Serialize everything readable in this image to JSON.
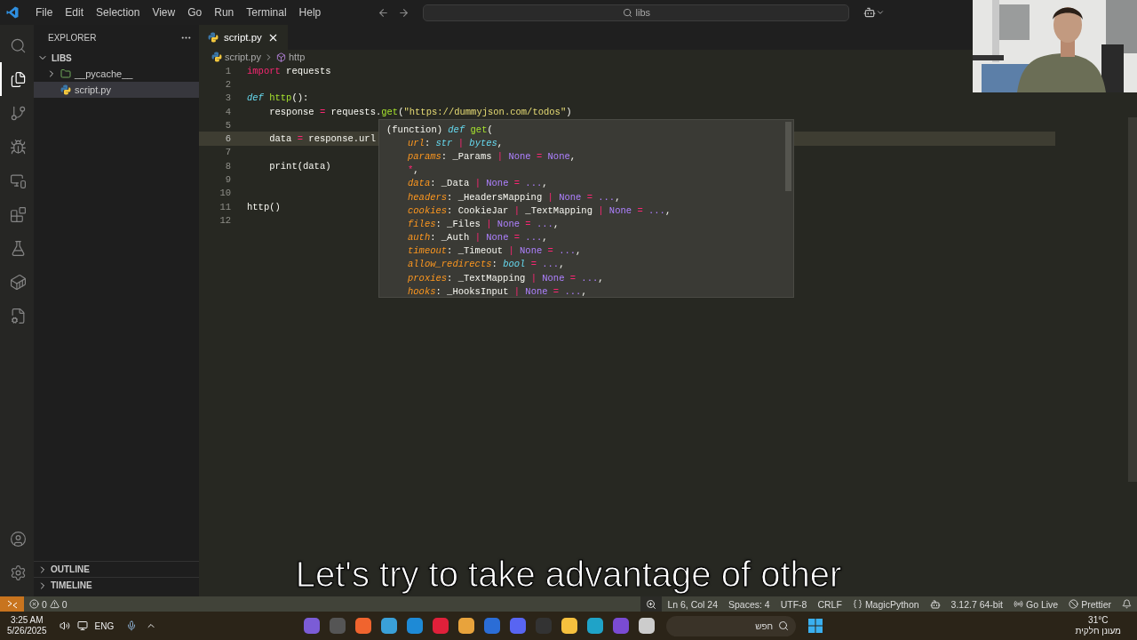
{
  "menu": [
    "File",
    "Edit",
    "Selection",
    "View",
    "Go",
    "Run",
    "Terminal",
    "Help"
  ],
  "search": {
    "value": "libs"
  },
  "activity": [
    {
      "selected": false
    },
    {
      "selected": true
    },
    {
      "selected": false
    },
    {
      "selected": false
    },
    {
      "selected": false
    },
    {
      "selected": false
    },
    {
      "selected": false
    },
    {
      "selected": false
    },
    {
      "selected": false
    }
  ],
  "explorer": {
    "title": "EXPLORER",
    "root": {
      "label": "LIBS",
      "expanded": true,
      "children": [
        {
          "label": "__pycache__",
          "kind": "folder",
          "expanded": false,
          "selected": false
        },
        {
          "label": "script.py",
          "kind": "python",
          "selected": true
        }
      ]
    }
  },
  "sections": [
    {
      "label": "OUTLINE",
      "expanded": false
    },
    {
      "label": "TIMELINE",
      "expanded": false
    }
  ],
  "tabs": [
    {
      "label": "script.py",
      "selected": true
    }
  ],
  "breadcrumbs": [
    "script.py",
    "http"
  ],
  "code": [
    {
      "number": "1",
      "selected": false,
      "tokens": [
        {
          "kind": "kw",
          "text": "import"
        },
        {
          "kind": "plain",
          "text": " requests"
        }
      ]
    },
    {
      "number": "2",
      "selected": false
    },
    {
      "number": "3",
      "selected": false,
      "tokens": [
        {
          "kind": "kwi",
          "text": "def "
        },
        {
          "kind": "fn",
          "text": "http"
        },
        {
          "kind": "plain",
          "text": "():"
        }
      ]
    },
    {
      "number": "4",
      "selected": false,
      "tokens": [
        {
          "kind": "plain",
          "text": "    response "
        },
        {
          "kind": "op",
          "text": "="
        },
        {
          "kind": "plain",
          "text": " requests."
        },
        {
          "kind": "fn",
          "text": "get"
        },
        {
          "kind": "plain",
          "text": "("
        },
        {
          "kind": "str",
          "text": "\"https://dummyjson.com/todos\""
        },
        {
          "kind": "plain",
          "text": ")"
        }
      ]
    },
    {
      "number": "5",
      "selected": false
    },
    {
      "number": "6",
      "selected": true,
      "tokens": [
        {
          "kind": "plain",
          "text": "    data "
        },
        {
          "kind": "op",
          "text": "="
        },
        {
          "kind": "plain",
          "text": " response.url"
        }
      ]
    },
    {
      "number": "7",
      "selected": false
    },
    {
      "number": "8",
      "selected": false,
      "tokens": [
        {
          "kind": "plain",
          "text": "    print(data)"
        }
      ]
    },
    {
      "number": "9",
      "selected": false
    },
    {
      "number": "10",
      "selected": false
    },
    {
      "number": "11",
      "selected": false,
      "tokens": [
        {
          "kind": "plain",
          "text": "http()"
        }
      ]
    },
    {
      "number": "12",
      "selected": false
    }
  ],
  "hover": [
    {
      "indented": false,
      "tokens": [
        {
          "kind": "plain",
          "text": "(function) "
        },
        {
          "kind": "kwi",
          "text": "def "
        },
        {
          "kind": "fn",
          "text": "get"
        },
        {
          "kind": "plain",
          "text": "("
        }
      ]
    },
    {
      "indented": true,
      "tokens": [
        {
          "kind": "param",
          "text": "url"
        },
        {
          "kind": "plain",
          "text": ": "
        },
        {
          "kind": "type",
          "text": "str"
        },
        {
          "kind": "op",
          "text": " | "
        },
        {
          "kind": "type",
          "text": "bytes"
        },
        {
          "kind": "plain",
          "text": ","
        }
      ]
    },
    {
      "indented": true,
      "tokens": [
        {
          "kind": "param",
          "text": "params"
        },
        {
          "kind": "plain",
          "text": ": _Params"
        },
        {
          "kind": "op",
          "text": " | "
        },
        {
          "kind": "none",
          "text": "None"
        },
        {
          "kind": "op",
          "text": " = "
        },
        {
          "kind": "none",
          "text": "None"
        },
        {
          "kind": "plain",
          "text": ","
        }
      ]
    },
    {
      "indented": true,
      "tokens": [
        {
          "kind": "op",
          "text": "*"
        },
        {
          "kind": "plain",
          "text": ","
        }
      ]
    },
    {
      "indented": true,
      "tokens": [
        {
          "kind": "param",
          "text": "data"
        },
        {
          "kind": "plain",
          "text": ": _Data"
        },
        {
          "kind": "op",
          "text": " | "
        },
        {
          "kind": "none",
          "text": "None"
        },
        {
          "kind": "op",
          "text": " = "
        },
        {
          "kind": "none",
          "text": "..."
        },
        {
          "kind": "plain",
          "text": ","
        }
      ]
    },
    {
      "indented": true,
      "tokens": [
        {
          "kind": "param",
          "text": "headers"
        },
        {
          "kind": "plain",
          "text": ": _HeadersMapping"
        },
        {
          "kind": "op",
          "text": " | "
        },
        {
          "kind": "none",
          "text": "None"
        },
        {
          "kind": "op",
          "text": " = "
        },
        {
          "kind": "none",
          "text": "..."
        },
        {
          "kind": "plain",
          "text": ","
        }
      ]
    },
    {
      "indented": true,
      "tokens": [
        {
          "kind": "param",
          "text": "cookies"
        },
        {
          "kind": "plain",
          "text": ": CookieJar"
        },
        {
          "kind": "op",
          "text": " | "
        },
        {
          "kind": "plain",
          "text": "_TextMapping"
        },
        {
          "kind": "op",
          "text": " | "
        },
        {
          "kind": "none",
          "text": "None"
        },
        {
          "kind": "op",
          "text": " = "
        },
        {
          "kind": "none",
          "text": "..."
        },
        {
          "kind": "plain",
          "text": ","
        }
      ]
    },
    {
      "indented": true,
      "tokens": [
        {
          "kind": "param",
          "text": "files"
        },
        {
          "kind": "plain",
          "text": ": _Files"
        },
        {
          "kind": "op",
          "text": " | "
        },
        {
          "kind": "none",
          "text": "None"
        },
        {
          "kind": "op",
          "text": " = "
        },
        {
          "kind": "none",
          "text": "..."
        },
        {
          "kind": "plain",
          "text": ","
        }
      ]
    },
    {
      "indented": true,
      "tokens": [
        {
          "kind": "param",
          "text": "auth"
        },
        {
          "kind": "plain",
          "text": ": _Auth"
        },
        {
          "kind": "op",
          "text": " | "
        },
        {
          "kind": "none",
          "text": "None"
        },
        {
          "kind": "op",
          "text": " = "
        },
        {
          "kind": "none",
          "text": "..."
        },
        {
          "kind": "plain",
          "text": ","
        }
      ]
    },
    {
      "indented": true,
      "tokens": [
        {
          "kind": "param",
          "text": "timeout"
        },
        {
          "kind": "plain",
          "text": ": _Timeout"
        },
        {
          "kind": "op",
          "text": " | "
        },
        {
          "kind": "none",
          "text": "None"
        },
        {
          "kind": "op",
          "text": " = "
        },
        {
          "kind": "none",
          "text": "..."
        },
        {
          "kind": "plain",
          "text": ","
        }
      ]
    },
    {
      "indented": true,
      "tokens": [
        {
          "kind": "param",
          "text": "allow_redirects"
        },
        {
          "kind": "plain",
          "text": ": "
        },
        {
          "kind": "type",
          "text": "bool"
        },
        {
          "kind": "op",
          "text": " = "
        },
        {
          "kind": "none",
          "text": "..."
        },
        {
          "kind": "plain",
          "text": ","
        }
      ]
    },
    {
      "indented": true,
      "tokens": [
        {
          "kind": "param",
          "text": "proxies"
        },
        {
          "kind": "plain",
          "text": ": _TextMapping"
        },
        {
          "kind": "op",
          "text": " | "
        },
        {
          "kind": "none",
          "text": "None"
        },
        {
          "kind": "op",
          "text": " = "
        },
        {
          "kind": "none",
          "text": "..."
        },
        {
          "kind": "plain",
          "text": ","
        }
      ]
    },
    {
      "indented": true,
      "tokens": [
        {
          "kind": "param",
          "text": "hooks"
        },
        {
          "kind": "plain",
          "text": ": _HooksInput"
        },
        {
          "kind": "op",
          "text": " | "
        },
        {
          "kind": "none",
          "text": "None"
        },
        {
          "kind": "op",
          "text": " = "
        },
        {
          "kind": "none",
          "text": "..."
        },
        {
          "kind": "plain",
          "text": ","
        }
      ]
    }
  ],
  "subtitle": "Let's try to take advantage of other",
  "status_left": {
    "errors": "0",
    "warnings": "0"
  },
  "status_right": [
    {
      "kind": "zoom"
    },
    {
      "kind": "text",
      "text": "Ln 6, Col 24"
    },
    {
      "kind": "text",
      "text": "Spaces: 4"
    },
    {
      "kind": "text",
      "text": "UTF-8"
    },
    {
      "kind": "text",
      "text": "CRLF"
    },
    {
      "kind": "braces",
      "text": "MagicPython"
    },
    {
      "kind": "copilot"
    },
    {
      "kind": "text",
      "text": "3.12.7 64-bit"
    },
    {
      "kind": "broadcast",
      "text": "Go Live"
    },
    {
      "kind": "prettier",
      "text": "Prettier"
    },
    {
      "kind": "bell"
    }
  ],
  "taskbar": {
    "time": "3:25 AM",
    "date": "5/26/2025",
    "language": "ENG",
    "search": {
      "placeholder": "חפש"
    },
    "weather": {
      "temperature": "31°C",
      "condition": "מעונן חלקית"
    }
  }
}
